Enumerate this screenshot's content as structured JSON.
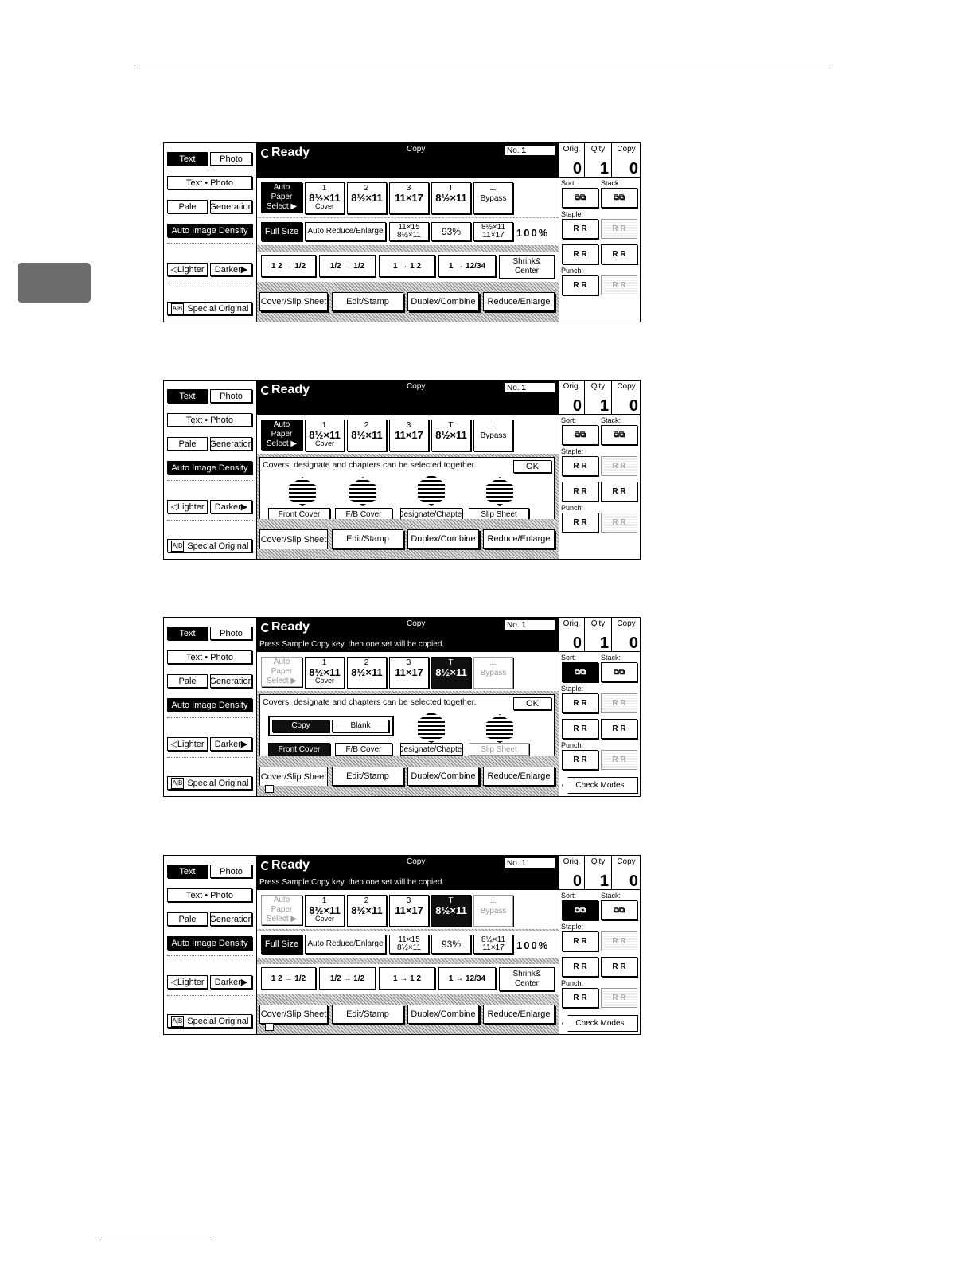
{
  "left_panel": {
    "text": "Text",
    "photo": "Photo",
    "text_photo": "Text • Photo",
    "pale": "Pale",
    "generation": "Generation",
    "auto_density": "Auto Image Density",
    "lighter": "◁Lighter",
    "darker": "Darker▶",
    "special_original": "Special Original",
    "special_icon": "A|B"
  },
  "header": {
    "ready": "Ready",
    "copy": "Copy",
    "no_label": "No.",
    "no_value": "1",
    "sample_msg": "Press Sample Copy key, then one set will be copied."
  },
  "trays": {
    "auto_paper": "Auto Paper",
    "select": "Select ▶",
    "t1_num": "1",
    "t1_size": "8½×11",
    "t1_sub": "Cover",
    "t2_num": "2",
    "t2_size": "8½×11",
    "t3_num": "3",
    "t3_size": "11×17",
    "t4_num": "T",
    "t4_size": "8½×11",
    "bypass": "Bypass",
    "bypass_icon": "⊥"
  },
  "ratio": {
    "full": "Full Size",
    "auto_reduce": "Auto Reduce/Enlarge",
    "r1a": "11×15",
    "r1b": "8½×11",
    "r2": "93%",
    "r3a": "8½×11",
    "r3b": "11×17",
    "pct": "100%"
  },
  "combine": {
    "c1": "1 2 → 1/2",
    "c2": "1/2 → 1/2",
    "c3": "1 → 1 2",
    "c4": "1 → 12/34",
    "shrink1": "Shrink&",
    "shrink2": "Center"
  },
  "tabs": {
    "cover": "Cover/Slip Sheet",
    "edit": "Edit/Stamp",
    "duplex": "Duplex/Combine",
    "reduce": "Reduce/Enlarge"
  },
  "cover_panel": {
    "msg": "Covers, designate and chapters can be selected together.",
    "ok": "OK",
    "front": "Front Cover",
    "fb": "F/B Cover",
    "designate": "Designate/Chapter",
    "slip": "Slip Sheet",
    "copy": "Copy",
    "blank": "Blank"
  },
  "counters": {
    "orig": "Orig.",
    "orig_val": "0",
    "qty": "Q'ty",
    "qty_val": "1",
    "copy": "Copy",
    "copy_val": "0"
  },
  "finisher": {
    "sort": "Sort:",
    "stack": "Stack:",
    "staple": "Staple:",
    "punch": "Punch:",
    "sort_glyph": "⧉⧉",
    "staple_glyph": "R R",
    "check_modes": "Check Modes"
  }
}
